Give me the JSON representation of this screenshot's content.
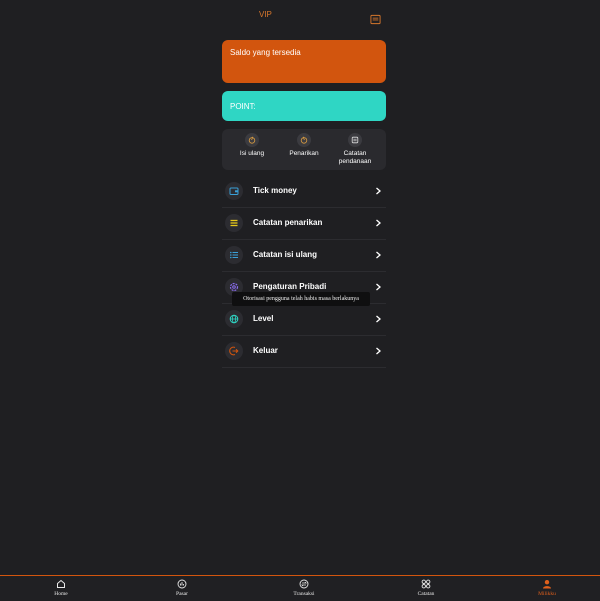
{
  "header": {
    "title": "VIP",
    "message_icon": "message-icon"
  },
  "balance_card": {
    "label": "Saldo yang tersedia",
    "color": "#d2550e"
  },
  "point_card": {
    "label": "POINT:",
    "color": "#2fd6c4"
  },
  "quick_actions": [
    {
      "label": "Isi ulang",
      "icon": "recharge-icon"
    },
    {
      "label": "Penarikan",
      "icon": "withdraw-icon"
    },
    {
      "label": "Catatan pendanaan",
      "icon": "funding-record-icon"
    }
  ],
  "menu": [
    {
      "label": "Tick money",
      "icon": "wallet-icon"
    },
    {
      "label": "Catatan penarikan",
      "icon": "list-lines-icon"
    },
    {
      "label": "Catatan isi ulang",
      "icon": "list-bullets-icon"
    },
    {
      "label": "Pengaturan Pribadi",
      "icon": "settings-icon"
    },
    {
      "label": "Level",
      "icon": "globe-icon"
    },
    {
      "label": "Keluar",
      "icon": "logout-icon"
    }
  ],
  "toast": {
    "text": "Otorisasi pengguna telah habis masa berlakunya"
  },
  "tabbar": {
    "items": [
      {
        "label": "Home",
        "icon": "home-icon"
      },
      {
        "label": "Pasar",
        "icon": "chart-icon"
      },
      {
        "label": "Transaksi",
        "icon": "exchange-icon"
      },
      {
        "label": "Catatan",
        "icon": "grid-icon"
      },
      {
        "label": "Milikku",
        "icon": "user-icon"
      }
    ],
    "active_index": 4,
    "accent": "#e0601c"
  }
}
